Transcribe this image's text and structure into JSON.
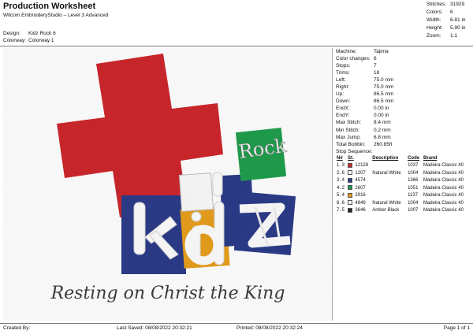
{
  "header": {
    "title": "Production Worksheet",
    "subtitle": "Wilcom EmbroideryStudio – Level 3 Advanced",
    "design_label": "Design:",
    "design_value": "Kidz Rock 6",
    "colorway_label": "Colorway:",
    "colorway_value": "Colorway 1"
  },
  "stats": [
    {
      "label": "Stitches:",
      "value": "31929"
    },
    {
      "label": "Colors:",
      "value": "6"
    },
    {
      "label": "Width:",
      "value": "6.81 in"
    },
    {
      "label": "Height:",
      "value": "5.90 in"
    },
    {
      "label": "Zoom:",
      "value": "1:1"
    }
  ],
  "machine_info": [
    {
      "label": "Machine:",
      "value": "Tajima"
    },
    {
      "label": "Color changes:",
      "value": "6"
    },
    {
      "label": "Stops:",
      "value": "7"
    },
    {
      "label": "Trims:",
      "value": "18"
    },
    {
      "label": "Left:",
      "value": "75.0 mm"
    },
    {
      "label": "Right:",
      "value": "75.0 mm"
    },
    {
      "label": "Up:",
      "value": "86.5 mm"
    },
    {
      "label": "Down:",
      "value": "86.5 mm"
    },
    {
      "label": "EndX:",
      "value": "0.00 in"
    },
    {
      "label": "EndY:",
      "value": "0.00 in"
    },
    {
      "label": "Max Stitch:",
      "value": "8.4 mm"
    },
    {
      "label": "Min Stitch:",
      "value": "0.2 mm"
    },
    {
      "label": "Max Jump:",
      "value": "6.8 mm"
    },
    {
      "label": "Total Bobbin:",
      "value": "260.85ft"
    }
  ],
  "stop_sequence": {
    "title": "Stop Sequence:",
    "headers": [
      "N#",
      "St.",
      "Description",
      "Code",
      "Brand"
    ],
    "rows": [
      {
        "n": "1. 3",
        "color": "#c8262b",
        "st": "12128",
        "desc": "",
        "code": "1037",
        "brand": "Madeira Classic 40"
      },
      {
        "n": "2. 6",
        "color": "#f4f4f4",
        "st": "1207",
        "desc": "Natural White",
        "code": "1004",
        "brand": "Madeira Classic 40"
      },
      {
        "n": "3. 4",
        "color": "#2b3a86",
        "st": "4574",
        "desc": "",
        "code": "1366",
        "brand": "Madeira Classic 40"
      },
      {
        "n": "4. 2",
        "color": "#1f9a4a",
        "st": "2607",
        "desc": "",
        "code": "1051",
        "brand": "Madeira Classic 40"
      },
      {
        "n": "5. 4",
        "color": "#e39b1c",
        "st": "2916",
        "desc": "",
        "code": "1137",
        "brand": "Madeira Classic 40"
      },
      {
        "n": "6. 6",
        "color": "#f4f4f4",
        "st": "4849",
        "desc": "Natural White",
        "code": "1004",
        "brand": "Madeira Classic 40"
      },
      {
        "n": "7. 5",
        "color": "#222222",
        "st": "3646",
        "desc": "Amber Black",
        "code": "1007",
        "brand": "Madeira Classic 40"
      }
    ]
  },
  "design": {
    "word_kidz": "kidz",
    "word_rock": "Rock",
    "tagline": "Resting on Christ the King",
    "colors": {
      "red": "#c8262b",
      "navy": "#2b3a86",
      "gold": "#e39b1c",
      "green": "#1f9a4a",
      "white": "#f4f4f4",
      "black": "#3a3a3a"
    }
  },
  "footer": {
    "created_by": "Created By:",
    "last_saved": "Last Saved: 08/08/2022 20:32:21",
    "printed": "Printed: 08/08/2022 20:32:24",
    "page": "Page 1 of 1"
  }
}
